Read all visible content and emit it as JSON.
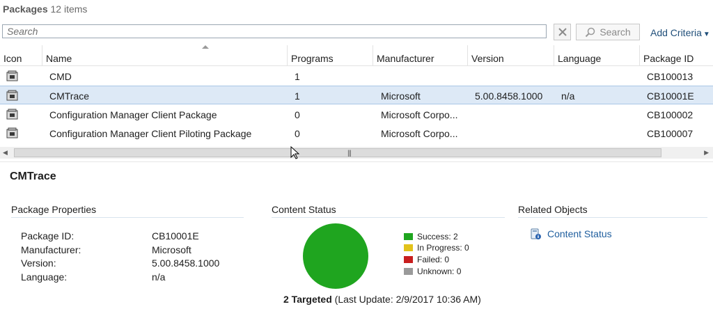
{
  "header": {
    "title": "Packages",
    "count": "12 items"
  },
  "search": {
    "placeholder": "Search",
    "value": "",
    "button_label": "Search",
    "add_criteria_label": "Add Criteria"
  },
  "grid": {
    "columns": [
      "Icon",
      "Name",
      "Programs",
      "Manufacturer",
      "Version",
      "Language",
      "Package ID"
    ],
    "rows": [
      {
        "name": "CMD",
        "programs": "1",
        "manufacturer": "",
        "version": "",
        "language": "",
        "package_id": "CB100013",
        "selected": false
      },
      {
        "name": "CMTrace",
        "programs": "1",
        "manufacturer": "Microsoft",
        "version": "5.00.8458.1000",
        "language": "n/a",
        "package_id": "CB10001E",
        "selected": true
      },
      {
        "name": "Configuration Manager Client Package",
        "programs": "0",
        "manufacturer": "Microsoft Corpo...",
        "version": "",
        "language": "",
        "package_id": "CB100002",
        "selected": false
      },
      {
        "name": "Configuration Manager Client Piloting Package",
        "programs": "0",
        "manufacturer": "Microsoft Corpo...",
        "version": "",
        "language": "",
        "package_id": "CB100007",
        "selected": false
      }
    ],
    "icon": "package-icon"
  },
  "details": {
    "title": "CMTrace",
    "package_properties": {
      "title": "Package Properties",
      "labels": {
        "package_id": "Package ID:",
        "manufacturer": "Manufacturer:",
        "version": "Version:",
        "language": "Language:"
      },
      "values": {
        "package_id": "CB10001E",
        "manufacturer": "Microsoft",
        "version": "5.00.8458.1000",
        "language": "n/a"
      }
    },
    "content_status": {
      "title": "Content Status",
      "legend": [
        {
          "label": "Success: 2",
          "color": "#1fa51f"
        },
        {
          "label": "In Progress: 0",
          "color": "#e2c21a"
        },
        {
          "label": "Failed: 0",
          "color": "#c81e1e"
        },
        {
          "label": "Unknown: 0",
          "color": "#9a9a9a"
        }
      ],
      "targeted": "2 Targeted",
      "last_update": "(Last Update: 2/9/2017 10:36 AM)"
    },
    "related_objects": {
      "title": "Related Objects",
      "link": "Content Status",
      "icon": "content-status-icon"
    }
  },
  "colors": {
    "selection": "#dde9f6",
    "link": "#1f5e9e",
    "success": "#1fa51f"
  }
}
